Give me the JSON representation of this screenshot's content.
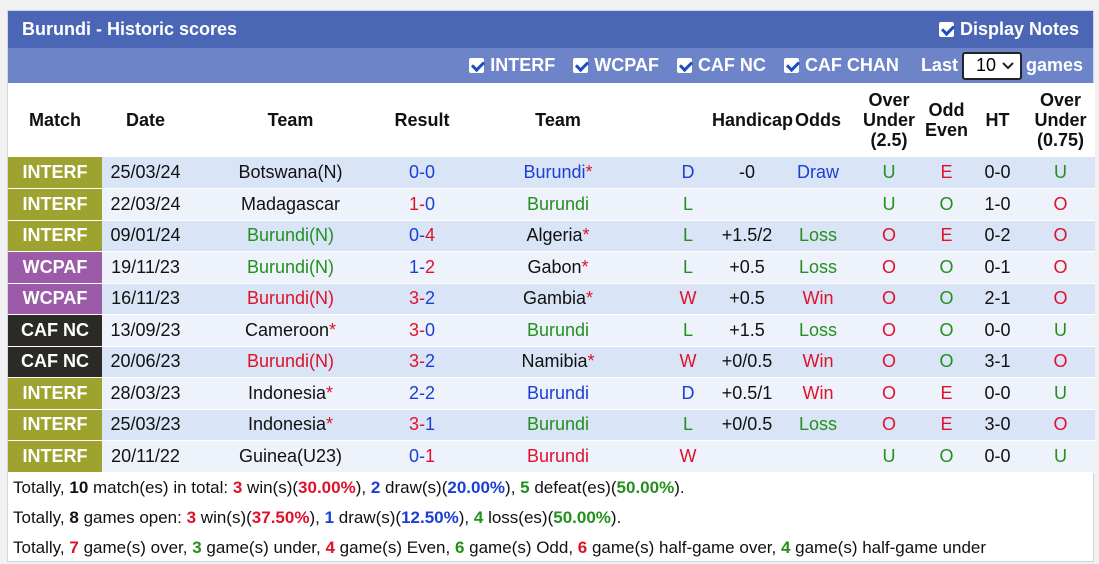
{
  "header": {
    "title": "Burundi - Historic scores",
    "display_notes_label": "Display Notes"
  },
  "filters": {
    "leagues": [
      "INTERF",
      "WCPAF",
      "CAF NC",
      "CAF CHAN"
    ],
    "last_label": "Last",
    "last_value": "10",
    "games_label": "games"
  },
  "columns": {
    "match": "Match",
    "date": "Date",
    "team1": "Team",
    "result": "Result",
    "team2": "Team",
    "handicap": "Handicap",
    "odds": "Odds",
    "ou1": "Over",
    "ou2": "Under",
    "ou3": "(2.5)",
    "oe1": "Odd",
    "oe2": "Even",
    "ht": "HT",
    "ouh1": "Over",
    "ouh2": "Under",
    "ouh3": "(0.75)"
  },
  "rows": [
    {
      "league": "INTERF",
      "lg": "interf",
      "date": "25/03/24",
      "t1": "Botswana(N)",
      "t1c": "dk",
      "s1": "0",
      "sep": "-",
      "s2": "0",
      "rc": "blue",
      "t2": "Burundi",
      "t2c": "blue",
      "star2": "*",
      "wdl": "D",
      "wdlc": "blue",
      "hcp": "-0",
      "odds": "Draw",
      "oddsc": "blue",
      "ou": "U",
      "ouc": "green",
      "oe": "E",
      "oec": "red",
      "ht": "0-0",
      "ouh": "U",
      "ouhc": "green"
    },
    {
      "league": "INTERF",
      "lg": "interf",
      "date": "22/03/24",
      "t1": "Madagascar",
      "t1c": "dk",
      "s1": "1",
      "sep": "-",
      "s2": "0",
      "rc": "red",
      "t2": "Burundi",
      "t2c": "green",
      "star2": "",
      "wdl": "L",
      "wdlc": "green",
      "hcp": "",
      "odds": "",
      "oddsc": "dk",
      "ou": "U",
      "ouc": "green",
      "oe": "O",
      "oec": "green",
      "ht": "1-0",
      "ouh": "O",
      "ouhc": "red"
    },
    {
      "league": "INTERF",
      "lg": "interf",
      "date": "09/01/24",
      "t1": "Burundi(N)",
      "t1c": "green",
      "s1": "0",
      "sep": "-",
      "s2": "4",
      "rc": "blue",
      "t2": "Algeria",
      "t2c": "dk",
      "star2": "*",
      "wdl": "L",
      "wdlc": "green",
      "hcp": "+1.5/2",
      "odds": "Loss",
      "oddsc": "green",
      "ou": "O",
      "ouc": "red",
      "oe": "E",
      "oec": "red",
      "ht": "0-2",
      "ouh": "O",
      "ouhc": "red"
    },
    {
      "league": "WCPAF",
      "lg": "wcpaf",
      "date": "19/11/23",
      "t1": "Burundi(N)",
      "t1c": "green",
      "s1": "1",
      "sep": "-",
      "s2": "2",
      "rc": "blue",
      "t2": "Gabon",
      "t2c": "dk",
      "star2": "*",
      "wdl": "L",
      "wdlc": "green",
      "hcp": "+0.5",
      "odds": "Loss",
      "oddsc": "green",
      "ou": "O",
      "ouc": "red",
      "oe": "O",
      "oec": "green",
      "ht": "0-1",
      "ouh": "O",
      "ouhc": "red"
    },
    {
      "league": "WCPAF",
      "lg": "wcpaf",
      "date": "16/11/23",
      "t1": "Burundi(N)",
      "t1c": "red",
      "s1": "3",
      "sep": "-",
      "s2": "2",
      "rc": "red",
      "t2": "Gambia",
      "t2c": "dk",
      "star2": "*",
      "wdl": "W",
      "wdlc": "red",
      "hcp": "+0.5",
      "odds": "Win",
      "oddsc": "red",
      "ou": "O",
      "ouc": "red",
      "oe": "O",
      "oec": "green",
      "ht": "2-1",
      "ouh": "O",
      "ouhc": "red"
    },
    {
      "league": "CAF NC",
      "lg": "cafnc",
      "date": "13/09/23",
      "t1": "Cameroon",
      "t1c": "dk",
      "star1": "*",
      "s1": "3",
      "sep": "-",
      "s2": "0",
      "rc": "red",
      "t2": "Burundi",
      "t2c": "green",
      "star2": "",
      "wdl": "L",
      "wdlc": "green",
      "hcp": "+1.5",
      "odds": "Loss",
      "oddsc": "green",
      "ou": "O",
      "ouc": "red",
      "oe": "O",
      "oec": "green",
      "ht": "0-0",
      "ouh": "U",
      "ouhc": "green"
    },
    {
      "league": "CAF NC",
      "lg": "cafnc",
      "date": "20/06/23",
      "t1": "Burundi(N)",
      "t1c": "red",
      "s1": "3",
      "sep": "-",
      "s2": "2",
      "rc": "red",
      "t2": "Namibia",
      "t2c": "dk",
      "star2": "*",
      "wdl": "W",
      "wdlc": "red",
      "hcp": "+0/0.5",
      "odds": "Win",
      "oddsc": "red",
      "ou": "O",
      "ouc": "red",
      "oe": "O",
      "oec": "green",
      "ht": "3-1",
      "ouh": "O",
      "ouhc": "red"
    },
    {
      "league": "INTERF",
      "lg": "interf",
      "date": "28/03/23",
      "t1": "Indonesia",
      "t1c": "dk",
      "star1": "*",
      "s1": "2",
      "sep": "-",
      "s2": "2",
      "rc": "blue",
      "t2": "Burundi",
      "t2c": "blue",
      "star2": "",
      "wdl": "D",
      "wdlc": "blue",
      "hcp": "+0.5/1",
      "odds": "Win",
      "oddsc": "red",
      "ou": "O",
      "ouc": "red",
      "oe": "E",
      "oec": "red",
      "ht": "0-0",
      "ouh": "U",
      "ouhc": "green"
    },
    {
      "league": "INTERF",
      "lg": "interf",
      "date": "25/03/23",
      "t1": "Indonesia",
      "t1c": "dk",
      "star1": "*",
      "s1": "3",
      "sep": "-",
      "s2": "1",
      "rc": "red",
      "t2": "Burundi",
      "t2c": "green",
      "star2": "",
      "wdl": "L",
      "wdlc": "green",
      "hcp": "+0/0.5",
      "odds": "Loss",
      "oddsc": "green",
      "ou": "O",
      "ouc": "red",
      "oe": "E",
      "oec": "red",
      "ht": "3-0",
      "ouh": "O",
      "ouhc": "red"
    },
    {
      "league": "INTERF",
      "lg": "interf",
      "date": "20/11/22",
      "t1": "Guinea(U23)",
      "t1c": "dk",
      "s1": "0",
      "sep": "-",
      "s2": "1",
      "rc": "blue",
      "t2": "Burundi",
      "t2c": "red",
      "star2": "",
      "wdl": "W",
      "wdlc": "red",
      "hcp": "",
      "odds": "",
      "oddsc": "dk",
      "ou": "U",
      "ouc": "green",
      "oe": "O",
      "oec": "green",
      "ht": "0-0",
      "ouh": "U",
      "ouhc": "green"
    }
  ],
  "summary": {
    "line1": [
      {
        "t": "Totally, "
      },
      {
        "t": "10",
        "b": 1
      },
      {
        "t": " match(es) in total: "
      },
      {
        "t": "3",
        "b": 1,
        "c": "red"
      },
      {
        "t": " win(s)("
      },
      {
        "t": "30.00%",
        "b": 1,
        "c": "red"
      },
      {
        "t": "), "
      },
      {
        "t": "2",
        "b": 1,
        "c": "blue"
      },
      {
        "t": " draw(s)("
      },
      {
        "t": "20.00%",
        "b": 1,
        "c": "blue"
      },
      {
        "t": "), "
      },
      {
        "t": "5",
        "b": 1,
        "c": "green"
      },
      {
        "t": " defeat(es)("
      },
      {
        "t": "50.00%",
        "b": 1,
        "c": "green"
      },
      {
        "t": ")."
      }
    ],
    "line2": [
      {
        "t": "Totally, "
      },
      {
        "t": "8",
        "b": 1
      },
      {
        "t": " games open: "
      },
      {
        "t": "3",
        "b": 1,
        "c": "red"
      },
      {
        "t": " win(s)("
      },
      {
        "t": "37.50%",
        "b": 1,
        "c": "red"
      },
      {
        "t": "), "
      },
      {
        "t": "1",
        "b": 1,
        "c": "blue"
      },
      {
        "t": " draw(s)("
      },
      {
        "t": "12.50%",
        "b": 1,
        "c": "blue"
      },
      {
        "t": "), "
      },
      {
        "t": "4",
        "b": 1,
        "c": "green"
      },
      {
        "t": " loss(es)("
      },
      {
        "t": "50.00%",
        "b": 1,
        "c": "green"
      },
      {
        "t": ")."
      }
    ],
    "line3": [
      {
        "t": "Totally, "
      },
      {
        "t": "7",
        "b": 1,
        "c": "red"
      },
      {
        "t": " game(s) over, "
      },
      {
        "t": "3",
        "b": 1,
        "c": "green"
      },
      {
        "t": " game(s) under, "
      },
      {
        "t": "4",
        "b": 1,
        "c": "red"
      },
      {
        "t": " game(s) Even, "
      },
      {
        "t": "6",
        "b": 1,
        "c": "green"
      },
      {
        "t": " game(s) Odd, "
      },
      {
        "t": "6",
        "b": 1,
        "c": "red"
      },
      {
        "t": " game(s) half-game over, "
      },
      {
        "t": "4",
        "b": 1,
        "c": "green"
      },
      {
        "t": " game(s) half-game under"
      }
    ]
  },
  "colors": {
    "title_bg": "#4a66b5",
    "filter_bg": "#6e84c9",
    "interf": "#9ea22f",
    "wcpaf": "#9b5ba8",
    "cafnc": "#2b2a26",
    "red": "#e0112b",
    "blue": "#1a3fd6",
    "green": "#23901e"
  }
}
